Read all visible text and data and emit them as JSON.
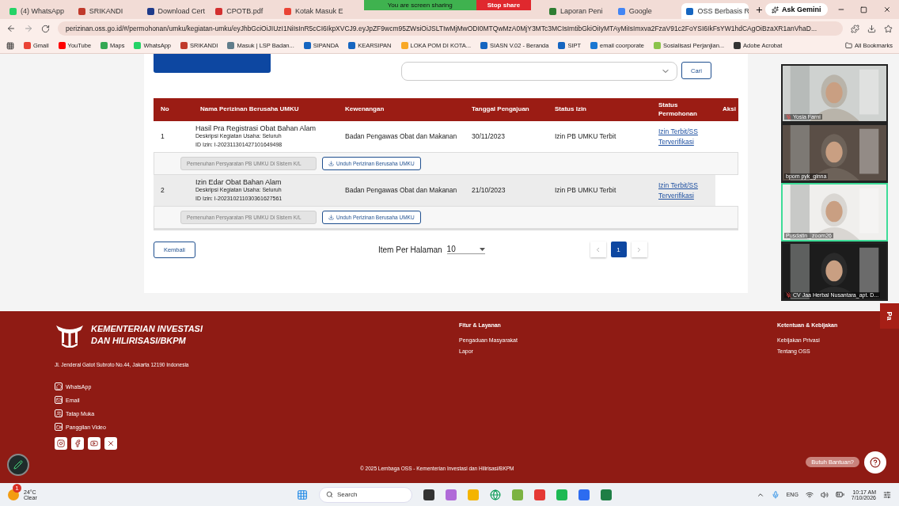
{
  "browser": {
    "tabs": [
      {
        "label": "(4) WhatsApp",
        "color": "#25d366",
        "selected": false
      },
      {
        "label": "SRIKANDI",
        "color": "#c0392b",
        "selected": false
      },
      {
        "label": "Download Cert",
        "color": "#1e3a8a",
        "selected": false
      },
      {
        "label": "CPOTB.pdf",
        "color": "#d32f2f",
        "selected": false
      },
      {
        "label": "Kotak Masuk E",
        "color": "#ea4335",
        "selected": false
      },
      {
        "label": "Laporan Peni",
        "color": "#2e7d32",
        "selected": false
      },
      {
        "label": "Google",
        "color": "#4285f4",
        "selected": false
      },
      {
        "label": "OSS Berbasis R",
        "color": "#1565c0",
        "selected": true
      }
    ],
    "gemini": "Ask Gemini",
    "sharing": {
      "notice": "You are screen sharing",
      "stop": "Stop share"
    },
    "url": "perizinan.oss.go.id/#/permohonan/umku/kegiatan-umku/eyJhbGciOiJIUzI1NiIsInR5cCI6IkpXVCJ9.eyJpZF9wcm95ZWsiOiJSLTIwMjMwODI0MTQwMzA0MjY3MTc3MCIsImtibGkiOiIyMTAyMiIsImxva2FzaV91c2FoYSI6IkFsYW1hdCAgOiBzaXR1anVhaD...",
    "bookmarks": [
      {
        "label": "Gmail",
        "color": "#ea4335"
      },
      {
        "label": "YouTube",
        "color": "#ff0000"
      },
      {
        "label": "Maps",
        "color": "#34a853"
      },
      {
        "label": "WhatsApp",
        "color": "#25d366"
      },
      {
        "label": "SRIKANDI",
        "color": "#c0392b"
      },
      {
        "label": "Masuk | LSP Badan...",
        "color": "#607d8b"
      },
      {
        "label": "SIPANDA",
        "color": "#1565c0"
      },
      {
        "label": "KEARSIPAN",
        "color": "#1565c0"
      },
      {
        "label": "LOKA POM DI KOTA...",
        "color": "#f9a825"
      },
      {
        "label": "SIASN V.02 - Beranda",
        "color": "#1565c0"
      },
      {
        "label": "SIPT",
        "color": "#1565c0"
      },
      {
        "label": "email coorporate",
        "color": "#1976d2"
      },
      {
        "label": "Sosialisasi Perjanjian...",
        "color": "#8bc34a"
      },
      {
        "label": "Adobe Acrobat",
        "color": "#333333"
      }
    ],
    "all_bookmarks": "All Bookmarks"
  },
  "page": {
    "search_button": "Cari",
    "table": {
      "columns": [
        "No",
        "Nama Perizinan Berusaha UMKU",
        "Kewenangan",
        "Tanggal Pengajuan",
        "Status Izin",
        "Status Permohonan",
        "Aksi"
      ],
      "rows": [
        {
          "no": "1",
          "name": "Hasil Pra Registrasi Obat Bahan Alam",
          "description": "Deskripsi Kegiatan Usaha: Seluruh",
          "id": "ID Izin: I-202311301427101649498",
          "authority": "Badan Pengawas Obat dan Makanan",
          "date": "30/11/2023",
          "status": "Izin PB UMKU Terbit",
          "request_status": "Izin Terbit/SS Terverifikasi",
          "highlighted": false,
          "actions": [
            {
              "label": "Pemenuhan Persyaratan PB UMKU Di Sistem K/L",
              "disabled": true
            },
            {
              "label": "Unduh Perizinan Berusaha UMKU",
              "disabled": false
            }
          ]
        },
        {
          "no": "2",
          "name": "Izin Edar Obat Bahan Alam",
          "description": "Deskripsi Kegiatan Usaha: Seluruh",
          "id": "ID Izin: I-202310211030361627561",
          "authority": "Badan Pengawas Obat dan Makanan",
          "date": "21/10/2023",
          "status": "Izin PB UMKU Terbit",
          "request_status": "Izin Terbit/SS Terverifikasi",
          "highlighted": true,
          "actions": [
            {
              "label": "Pemenuhan Persyaratan PB UMKU Di Sistem K/L",
              "disabled": true
            },
            {
              "label": "Unduh Perizinan Berusaha UMKU",
              "disabled": false
            }
          ]
        }
      ]
    },
    "back_button": "Kembali",
    "per_page_label": "Item Per Halaman",
    "per_page": "10",
    "pages": [
      {
        "label": "1",
        "selected": true
      }
    ]
  },
  "footer": {
    "org_line1": "KEMENTERIAN INVESTASI",
    "org_line2": "DAN HILIRISASI/BKPM",
    "address": "Jl. Jenderal Gatot Subroto No.44, Jakarta 12190 Indonesia",
    "contacts": [
      {
        "kind": "whatsapp",
        "label": "WhatsApp"
      },
      {
        "kind": "email",
        "label": "Email"
      },
      {
        "kind": "meet",
        "label": "Tatap Muka"
      },
      {
        "kind": "video",
        "label": "Panggilan Video"
      }
    ],
    "socials": [
      {
        "kind": "instagram"
      },
      {
        "kind": "facebook"
      },
      {
        "kind": "youtube"
      },
      {
        "kind": "x"
      }
    ],
    "columns": [
      {
        "title": "Fitur & Layanan",
        "links": [
          "Pengaduan Masyarakat",
          "Lapor"
        ]
      },
      {
        "title": "Ketentuan & Kebijakan",
        "links": [
          "Kebijakan Privasi",
          "Tentang OSS"
        ]
      }
    ],
    "copyright": "© 2025 Lembaga OSS - Kementerian Investasi dan Hilirisasi/BKPM",
    "help": "Butuh Bantuan?",
    "side_tab": "Pa"
  },
  "meeting": {
    "participants": [
      {
        "name": "Yosia Farni",
        "muted": true,
        "speaking": false,
        "color": "#b9b4aa"
      },
      {
        "name": "bpom pyk_ginna",
        "muted": false,
        "speaking": false,
        "color": "#6d6259"
      },
      {
        "name": "Pusdatin_ zoom26",
        "muted": false,
        "speaking": true,
        "color": "#d9d6d2"
      },
      {
        "name": "CV Jaa Herbal Nusantara_apt. D...",
        "muted": true,
        "speaking": false,
        "color": "#2a2a2a"
      }
    ]
  },
  "taskbar": {
    "temperature": "24°C",
    "weather": "Clear",
    "badge": "1",
    "search": "Search",
    "language": "ENG",
    "time": "10:17 AM",
    "date": "7/10/2026"
  }
}
